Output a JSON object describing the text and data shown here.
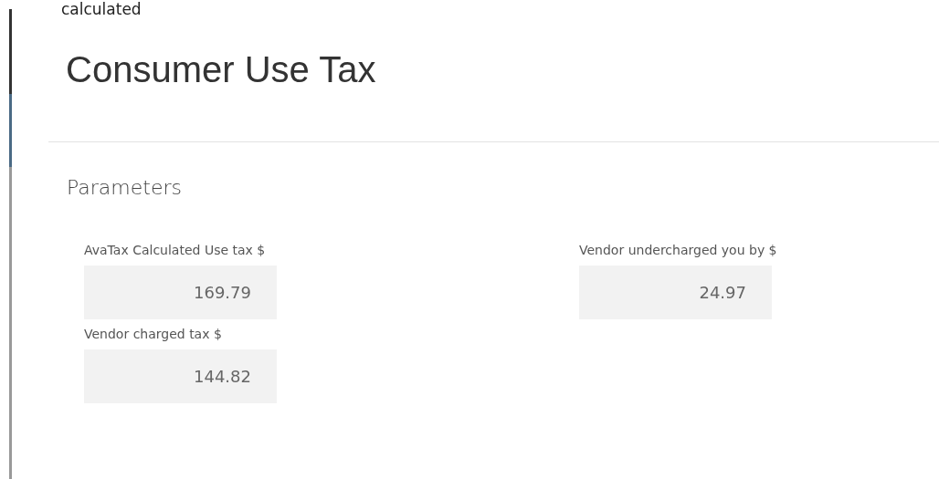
{
  "cut_text": "calculated",
  "page": {
    "title": "Consumer Use Tax"
  },
  "section": {
    "title": "Parameters"
  },
  "columns": [
    [
      {
        "label": "AvaTax Calculated Use tax $",
        "value": "169.79"
      },
      {
        "label": "Vendor charged tax $",
        "value": "144.82"
      }
    ],
    [
      {
        "label": "Vendor undercharged you by $",
        "value": "24.97"
      }
    ]
  ]
}
